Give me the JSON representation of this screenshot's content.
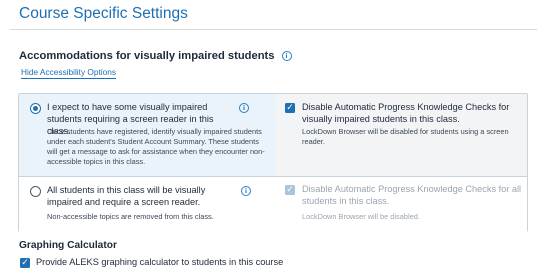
{
  "page": {
    "title": "Course Specific Settings"
  },
  "accommodations": {
    "heading": "Accommodations for visually impaired students",
    "info_icon": "info-icon",
    "hide_link": "Hide Accessibility Options",
    "options": [
      {
        "selected": true,
        "label": "I expect to have some visually impaired students requiring a screen reader in this class.",
        "description": "Once students have registered, identify visually impaired students under each student's Student Account Summary. These students will get a message to ask for assistance when they encounter non-accessible topics in this class.",
        "checkbox_checked": true,
        "checkbox_disabled": false,
        "checkbox_label": "Disable Automatic Progress Knowledge Checks for visually impaired students in this class.",
        "checkbox_description": "LockDown Browser will be disabled for students using a screen reader."
      },
      {
        "selected": false,
        "label": "All students in this class will be visually impaired and require a screen reader.",
        "description": "Non-accessible topics are removed from this class.",
        "checkbox_checked": true,
        "checkbox_disabled": true,
        "checkbox_label": "Disable Automatic Progress Knowledge Checks for all students in this class.",
        "checkbox_description": "LockDown Browser will be disabled."
      }
    ]
  },
  "graphing": {
    "heading": "Graphing Calculator",
    "checkbox_checked": true,
    "checkbox_label": "Provide ALEKS graphing calculator to students in this course"
  },
  "colors": {
    "accent": "#1f6fb2",
    "selected_row_bg": "#eaf3fa",
    "disabled_text": "#9aa5b0"
  }
}
